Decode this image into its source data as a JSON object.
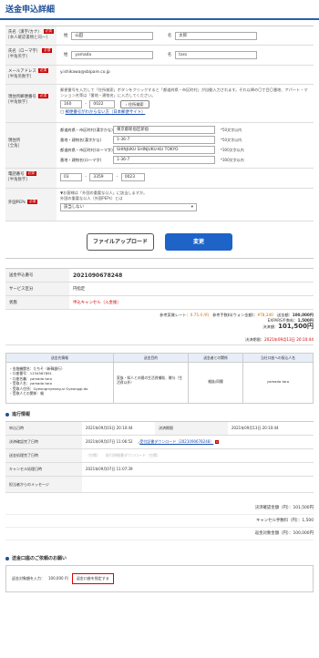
{
  "title": "送金申込詳細",
  "form": {
    "name_kanji": {
      "label": "氏名（漢字/カナ）",
      "sub": "[本人確認書類と同一]",
      "req": "必須",
      "last_label": "姓",
      "last": "山田",
      "first_label": "名",
      "first": "太郎"
    },
    "name_roman": {
      "label": "氏名（ローマ字）",
      "sub": "[半角英字]",
      "req": "必須",
      "last_label": "姓",
      "last": "yamada",
      "first_label": "名",
      "first": "taro"
    },
    "email": {
      "label": "メールアドレス",
      "sub": "[半角英数字]",
      "req": "必須",
      "value": "y.ishikawa@sbipare.co.jp"
    },
    "postal": {
      "label": "現住所郵便番号",
      "sub": "[半角数字]",
      "req": "必須",
      "note": "郵便番号を入力して「住所検索」ボタンをクリックすると「都道府県・市区町村」が自動入力されます。それ以降の〇丁目〇番地、アパート・マンション名等は「番地・建物名」に入力してください。",
      "p1": "160",
      "p2": "0022",
      "search_btn": "住所検索",
      "help_link": "郵便番号がわからない方（日本郵便サイト）"
    },
    "address": {
      "label": "現住所",
      "sub": "[全角]",
      "rows": [
        {
          "k": "都道府県・市区町村(漢字かな)",
          "v": "東京都新宿区新宿",
          "m": "*50文字以内"
        },
        {
          "k": "番地・建物名(漢字かな)",
          "v": "1-36-7",
          "m": "*50文字以内"
        },
        {
          "k": "都道府県・市区町村(ローマ字)",
          "v": "SHINJUKU SHINJUKU-KU TOKYO",
          "m": "*300文字以内"
        },
        {
          "k": "番地・建物名(ローマ字)",
          "v": "1-36-7",
          "m": "*300文字以内"
        }
      ]
    },
    "phone": {
      "label": "電話番号",
      "sub": "[半角数字]",
      "req": "必須",
      "p1": "03",
      "p2": "3359",
      "p3": "0023"
    },
    "peps": {
      "label": "外国PEPs",
      "req": "必須",
      "note1": "▼お客様は「外国の重要な公人」に該当しますか。",
      "link": "外国の重要な公人（外国PEPs）とは",
      "select": "該当しない"
    }
  },
  "buttons": {
    "upload": "ファイルアップロード",
    "change": "変更"
  },
  "info": {
    "rows": [
      {
        "k": "送金申込番号",
        "v": "2021090678248"
      },
      {
        "k": "サービス区分",
        "v": "円指定"
      },
      {
        "k": "状態",
        "v": "申込キャンセル（入金後）"
      }
    ]
  },
  "fees": {
    "line1_a": "参考実質レート：",
    "line1_rate": "0.75.4 /円",
    "line1_b": "　参考手数料(ウォン金額)：",
    "line1_won": "¥78,340",
    "line1_c": "　送金額：",
    "line1_amt": "100,000円",
    "line2_a": "EXPARS手数料：",
    "line2_v": "1,500円",
    "line3_a": "決済額：",
    "line3_v": "101,500円",
    "date_a": "決済期限：",
    "date_v": "2021年09月13日 20:10:44"
  },
  "recipient": {
    "headers": [
      "送金先情報",
      "送金目的",
      "送金者との関係",
      "当社口座への振込人名"
    ],
    "bank_lines": [
      "・金融機関名：たちそ（新韓銀行）",
      "・口座番号：1234567891",
      "・口座名義：yamada taro",
      "・受取人名：yamada taro",
      "・受取人住所：Gyeongmyeong-si Gyeonggi-do",
      "・受取人との関係：親"
    ],
    "purpose": "家族・知人との間の生活費補助、贈与（生活費以外）",
    "relation": "親族/同種",
    "payer": "yamada taro"
  },
  "progress": {
    "title": "進行情報",
    "rows": [
      {
        "k": "申込日時",
        "v": "2021年09月03日 20:10:44",
        "k2": "決済期限",
        "v2": "2021年09月13日 20:10:44"
      },
      {
        "k": "決済確認完了日時",
        "v": "2021年09月07日 11:06:52",
        "link": "受付証書ダウンロード（2021090678248）"
      },
      {
        "k": "送金処理完了日時",
        "v": "（空欄）",
        "link": "取引明細書ダウンロード（空欄）"
      },
      {
        "k": "キャンセル処理日時",
        "v": "2021年09月07日 11:07:39"
      },
      {
        "k": "担当者からのメッセージ",
        "v": ""
      }
    ]
  },
  "summary": {
    "s1": "決済確認金額（円）：101,500円",
    "s2": "キャンセル手数料（円）：1,500",
    "s3": "返金対象金額（円）：100,000円"
  },
  "bank": {
    "title": "送金口座のご依頼のお願い",
    "text": "返金対象額を入力：　100,000 円",
    "btn": "返金口座を指定する"
  },
  "colors": {
    "accent": "#1f4f96",
    "required": "#cc0000",
    "change_btn": "#1e63c8"
  }
}
